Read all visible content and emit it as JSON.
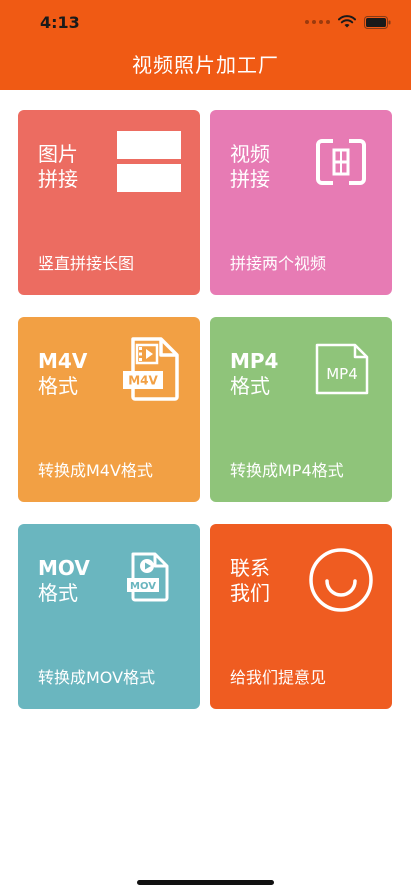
{
  "status": {
    "time": "4:13"
  },
  "nav": {
    "title": "视频照片加工厂"
  },
  "tiles": [
    {
      "title_line1": "图片",
      "title_line2": "拼接",
      "desc": "竖直拼接长图",
      "icon": "vertical-stack-icon",
      "color": "#ec6c61"
    },
    {
      "title_line1": "视频",
      "title_line2": "拼接",
      "desc": "拼接两个视频",
      "icon": "video-join-icon",
      "color": "#e77bb4"
    },
    {
      "title_line1": "M4V",
      "title_line2": "格式",
      "desc": "转换成M4V格式",
      "icon": "m4v-file-icon",
      "icon_label": "M4V",
      "color": "#f2a044"
    },
    {
      "title_line1": "MP4",
      "title_line2": "格式",
      "desc": "转换成MP4格式",
      "icon": "mp4-file-icon",
      "icon_label": "MP4",
      "color": "#8fc47a"
    },
    {
      "title_line1": "MOV",
      "title_line2": "格式",
      "desc": "转换成MOV格式",
      "icon": "mov-file-icon",
      "icon_label": "MOV",
      "color": "#6ab6bf"
    },
    {
      "title_line1": "联系",
      "title_line2": "我们",
      "desc": "给我们提意见",
      "icon": "smile-icon",
      "color": "#ef5c21"
    }
  ]
}
